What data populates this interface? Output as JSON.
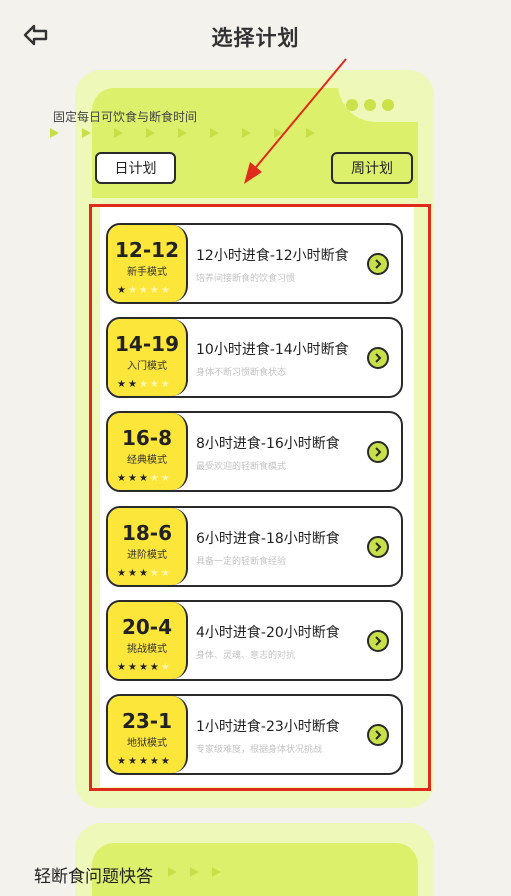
{
  "header": {
    "title": "选择计划",
    "back_icon": "back-arrow-icon"
  },
  "plan_section": {
    "subtitle": "固定每日可饮食与断食时间",
    "tabs": [
      {
        "label": "日计划"
      },
      {
        "label": "周计划"
      }
    ]
  },
  "plans": [
    {
      "code": "12-12",
      "mode": "新手模式",
      "stars": 1,
      "title": "12小时进食-12小时断食",
      "desc": "培养间接断食的饮食习惯"
    },
    {
      "code": "14-19",
      "mode": "入门模式",
      "stars": 2,
      "title": "10小时进食-14小时断食",
      "desc": "身体不断习惯断食状态"
    },
    {
      "code": "16-8",
      "mode": "经典模式",
      "stars": 3,
      "title": "8小时进食-16小时断食",
      "desc": "最受欢迎的轻断食模式"
    },
    {
      "code": "18-6",
      "mode": "进阶模式",
      "stars": 3,
      "title": "6小时进食-18小时断食",
      "desc": "具备一定的轻断食经验"
    },
    {
      "code": "20-4",
      "mode": "挑战模式",
      "stars": 4,
      "title": "4小时进食-20小时断食",
      "desc": "身体、灵魂、意志的对抗"
    },
    {
      "code": "23-1",
      "mode": "地狱模式",
      "stars": 5,
      "title": "1小时进食-23小时断食",
      "desc": "专家级难度，根据身体状况挑战"
    }
  ],
  "faq": {
    "title": "轻断食问题快答"
  },
  "colors": {
    "accent": "#ddf06c",
    "badge": "#fde63a",
    "highlight": "#e02a1c"
  }
}
